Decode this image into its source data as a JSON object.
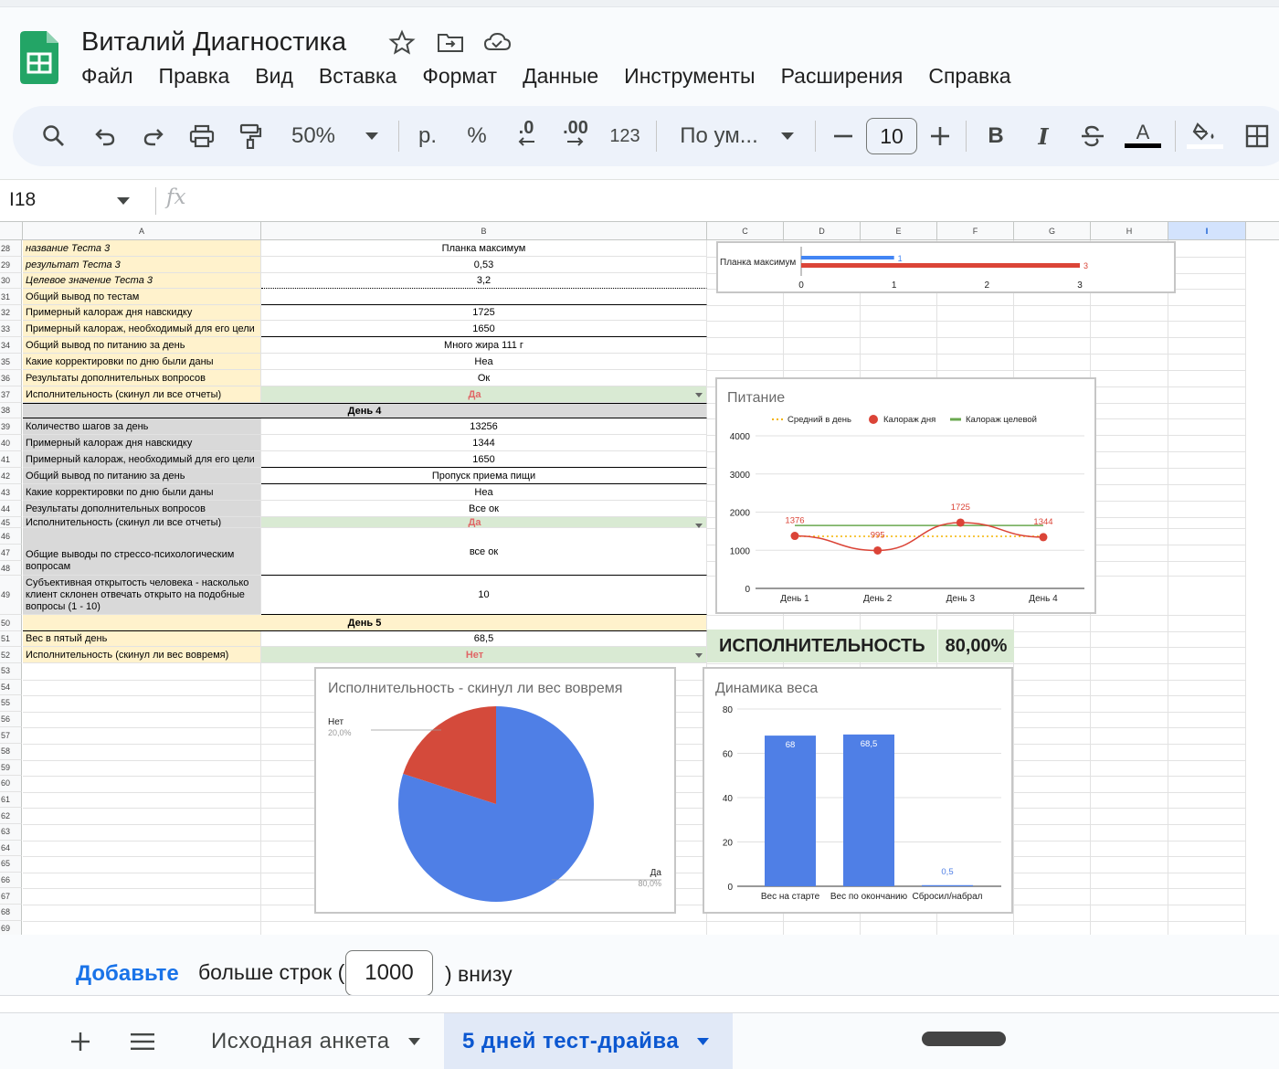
{
  "app": {
    "doc_title": "Виталий Диагностика",
    "menu": [
      "Файл",
      "Правка",
      "Вид",
      "Вставка",
      "Формат",
      "Данные",
      "Инструменты",
      "Расширения",
      "Справка"
    ]
  },
  "toolbar": {
    "zoom": "50%",
    "currency": "р.",
    "percent": "%",
    "dec_less": ".0",
    "dec_more": ".00",
    "number_format": "123",
    "font": "По ум...",
    "font_size": "10",
    "bold": "B",
    "italic": "I",
    "text_color": "A"
  },
  "formula_bar": {
    "cell_ref": "I18",
    "fx": "fx"
  },
  "columns": [
    "A",
    "B",
    "C",
    "D",
    "E",
    "F",
    "G",
    "H",
    "I"
  ],
  "rows": [
    {
      "n": "28",
      "a": "название Теста 3",
      "b": "Планка максимум",
      "style": "yellow ital"
    },
    {
      "n": "29",
      "a": "результат Теста 3",
      "b": "0,53",
      "style": "yellow ital"
    },
    {
      "n": "30",
      "a": "Целевое значение Теста 3",
      "b": "3,2",
      "style": "yellow ital"
    },
    {
      "n": "31",
      "a": "Общий вывод по тестам",
      "b": "",
      "style": "yellow"
    },
    {
      "n": "32",
      "a": "Примерный калораж дня навскидку",
      "b": "1725",
      "style": "yellow"
    },
    {
      "n": "33",
      "a": "Примерный калораж, необходимый для его цели",
      "b": "1650",
      "style": "yellow"
    },
    {
      "n": "34",
      "a": "Общий вывод по питанию за день",
      "b": "Много жира 111 г",
      "style": "yellow"
    },
    {
      "n": "35",
      "a": "Какие корректировки по дню были даны",
      "b": "Неа",
      "style": "yellow"
    },
    {
      "n": "36",
      "a": "Результаты дополнительных вопросов",
      "b": "Ок",
      "style": "yellow"
    },
    {
      "n": "37",
      "a": "Исполнительность (скинул ли все отчеты)",
      "b": "Да",
      "style": "yellow green-b"
    },
    {
      "n": "38",
      "a": "",
      "b": "День 4",
      "style": "day-grey"
    },
    {
      "n": "39",
      "a": "Количество шагов за день",
      "b": "13256",
      "style": "grey"
    },
    {
      "n": "40",
      "a": "Примерный калораж дня навскидку",
      "b": "1344",
      "style": "grey"
    },
    {
      "n": "41",
      "a": "Примерный калораж, необходимый для его цели",
      "b": "1650",
      "style": "grey"
    },
    {
      "n": "42",
      "a": "Общий вывод по питанию за день",
      "b": "Пропуск приема пищи",
      "style": "grey"
    },
    {
      "n": "43",
      "a": "Какие корректировки по дню были даны",
      "b": "Неа",
      "style": "grey"
    },
    {
      "n": "44",
      "a": "Результаты дополнительных вопросов",
      "b": "Все ок",
      "style": "grey"
    },
    {
      "n": "45",
      "a": "Исполнительность (скинул ли все отчеты)",
      "b": "Да",
      "style": "grey green-b"
    }
  ],
  "rows_merged": {
    "r46_47_48_a": "Общие выводы по стрессо-психологическим вопросам",
    "r46_47_48_b": "все ок",
    "r49_a": "Субъективная открытость человека - насколько клиент склонен отвечать открыто на подобные вопросы (1 - 10)",
    "r49_b": "10",
    "r50_b": "День 5",
    "r51_a": "Вес в пятый день",
    "r51_b": "68,5",
    "r52_a": "Исполнительность (скинул ли вес вовремя)",
    "r52_b": "Нет"
  },
  "row_numbers_extra": [
    "46",
    "47",
    "48",
    "49",
    "50",
    "51",
    "52",
    "53",
    "54",
    "55",
    "56",
    "57",
    "58",
    "59",
    "60",
    "61",
    "62",
    "63",
    "64",
    "65",
    "66",
    "67",
    "68",
    "69"
  ],
  "performance": {
    "label": "ИСПОЛНИТЕЛЬНОСТЬ",
    "value": "80,00%"
  },
  "chart_data": [
    {
      "type": "bar",
      "orientation": "horizontal",
      "categories": [
        "Планка максимум"
      ],
      "series": [
        {
          "values": [
            1
          ],
          "color": "#4285f4"
        },
        {
          "values": [
            3
          ],
          "color": "#db4437"
        }
      ],
      "data_labels": [
        "1",
        "3"
      ],
      "xlim": [
        0,
        3
      ],
      "xticks": [
        "0",
        "1",
        "2",
        "3"
      ]
    },
    {
      "type": "line",
      "title": "Питание",
      "categories": [
        "День 1",
        "День 2",
        "День 3",
        "День 4"
      ],
      "series": [
        {
          "name": "Средний в день",
          "values": [
            1365,
            1365,
            1365,
            1365
          ],
          "color": "#f4b400",
          "style": "dotted"
        },
        {
          "name": "Калораж дня",
          "values": [
            1376,
            995,
            1725,
            1344
          ],
          "color": "#db4437"
        },
        {
          "name": "Калораж целевой",
          "values": [
            1650,
            1650,
            1650,
            1650
          ],
          "color": "#6aa84f"
        }
      ],
      "data_labels": [
        "1376",
        "995",
        "1725",
        "1344"
      ],
      "ylim": [
        0,
        4000
      ],
      "yticks": [
        "0",
        "1000",
        "2000",
        "3000",
        "4000"
      ],
      "legend": "top"
    },
    {
      "type": "pie",
      "title": "Исполнительность - скинул ли вес вовремя",
      "slices": [
        {
          "label": "Да",
          "value": 80.0,
          "pct": "80,0%",
          "color": "#4f7fe6"
        },
        {
          "label": "Нет",
          "value": 20.0,
          "pct": "20,0%",
          "color": "#d44a3b"
        }
      ]
    },
    {
      "type": "bar",
      "title": "Динамика веса",
      "categories": [
        "Вес на старте",
        "Вес по окончанию",
        "Сбросил/набрал"
      ],
      "values": [
        68,
        68.5,
        0.5
      ],
      "data_labels": [
        "68",
        "68,5",
        "0,5"
      ],
      "ylim": [
        0,
        80
      ],
      "yticks": [
        "0",
        "20",
        "40",
        "60",
        "80"
      ],
      "color": "#4f7fe6"
    }
  ],
  "add_rows": {
    "link": "Добавьте",
    "text1": "больше строк (",
    "count": "1000",
    "text2": ") внизу"
  },
  "sheet_tabs": [
    {
      "label": "Исходная анкета",
      "active": false
    },
    {
      "label": "5 дней тест-драйва",
      "active": true
    }
  ]
}
